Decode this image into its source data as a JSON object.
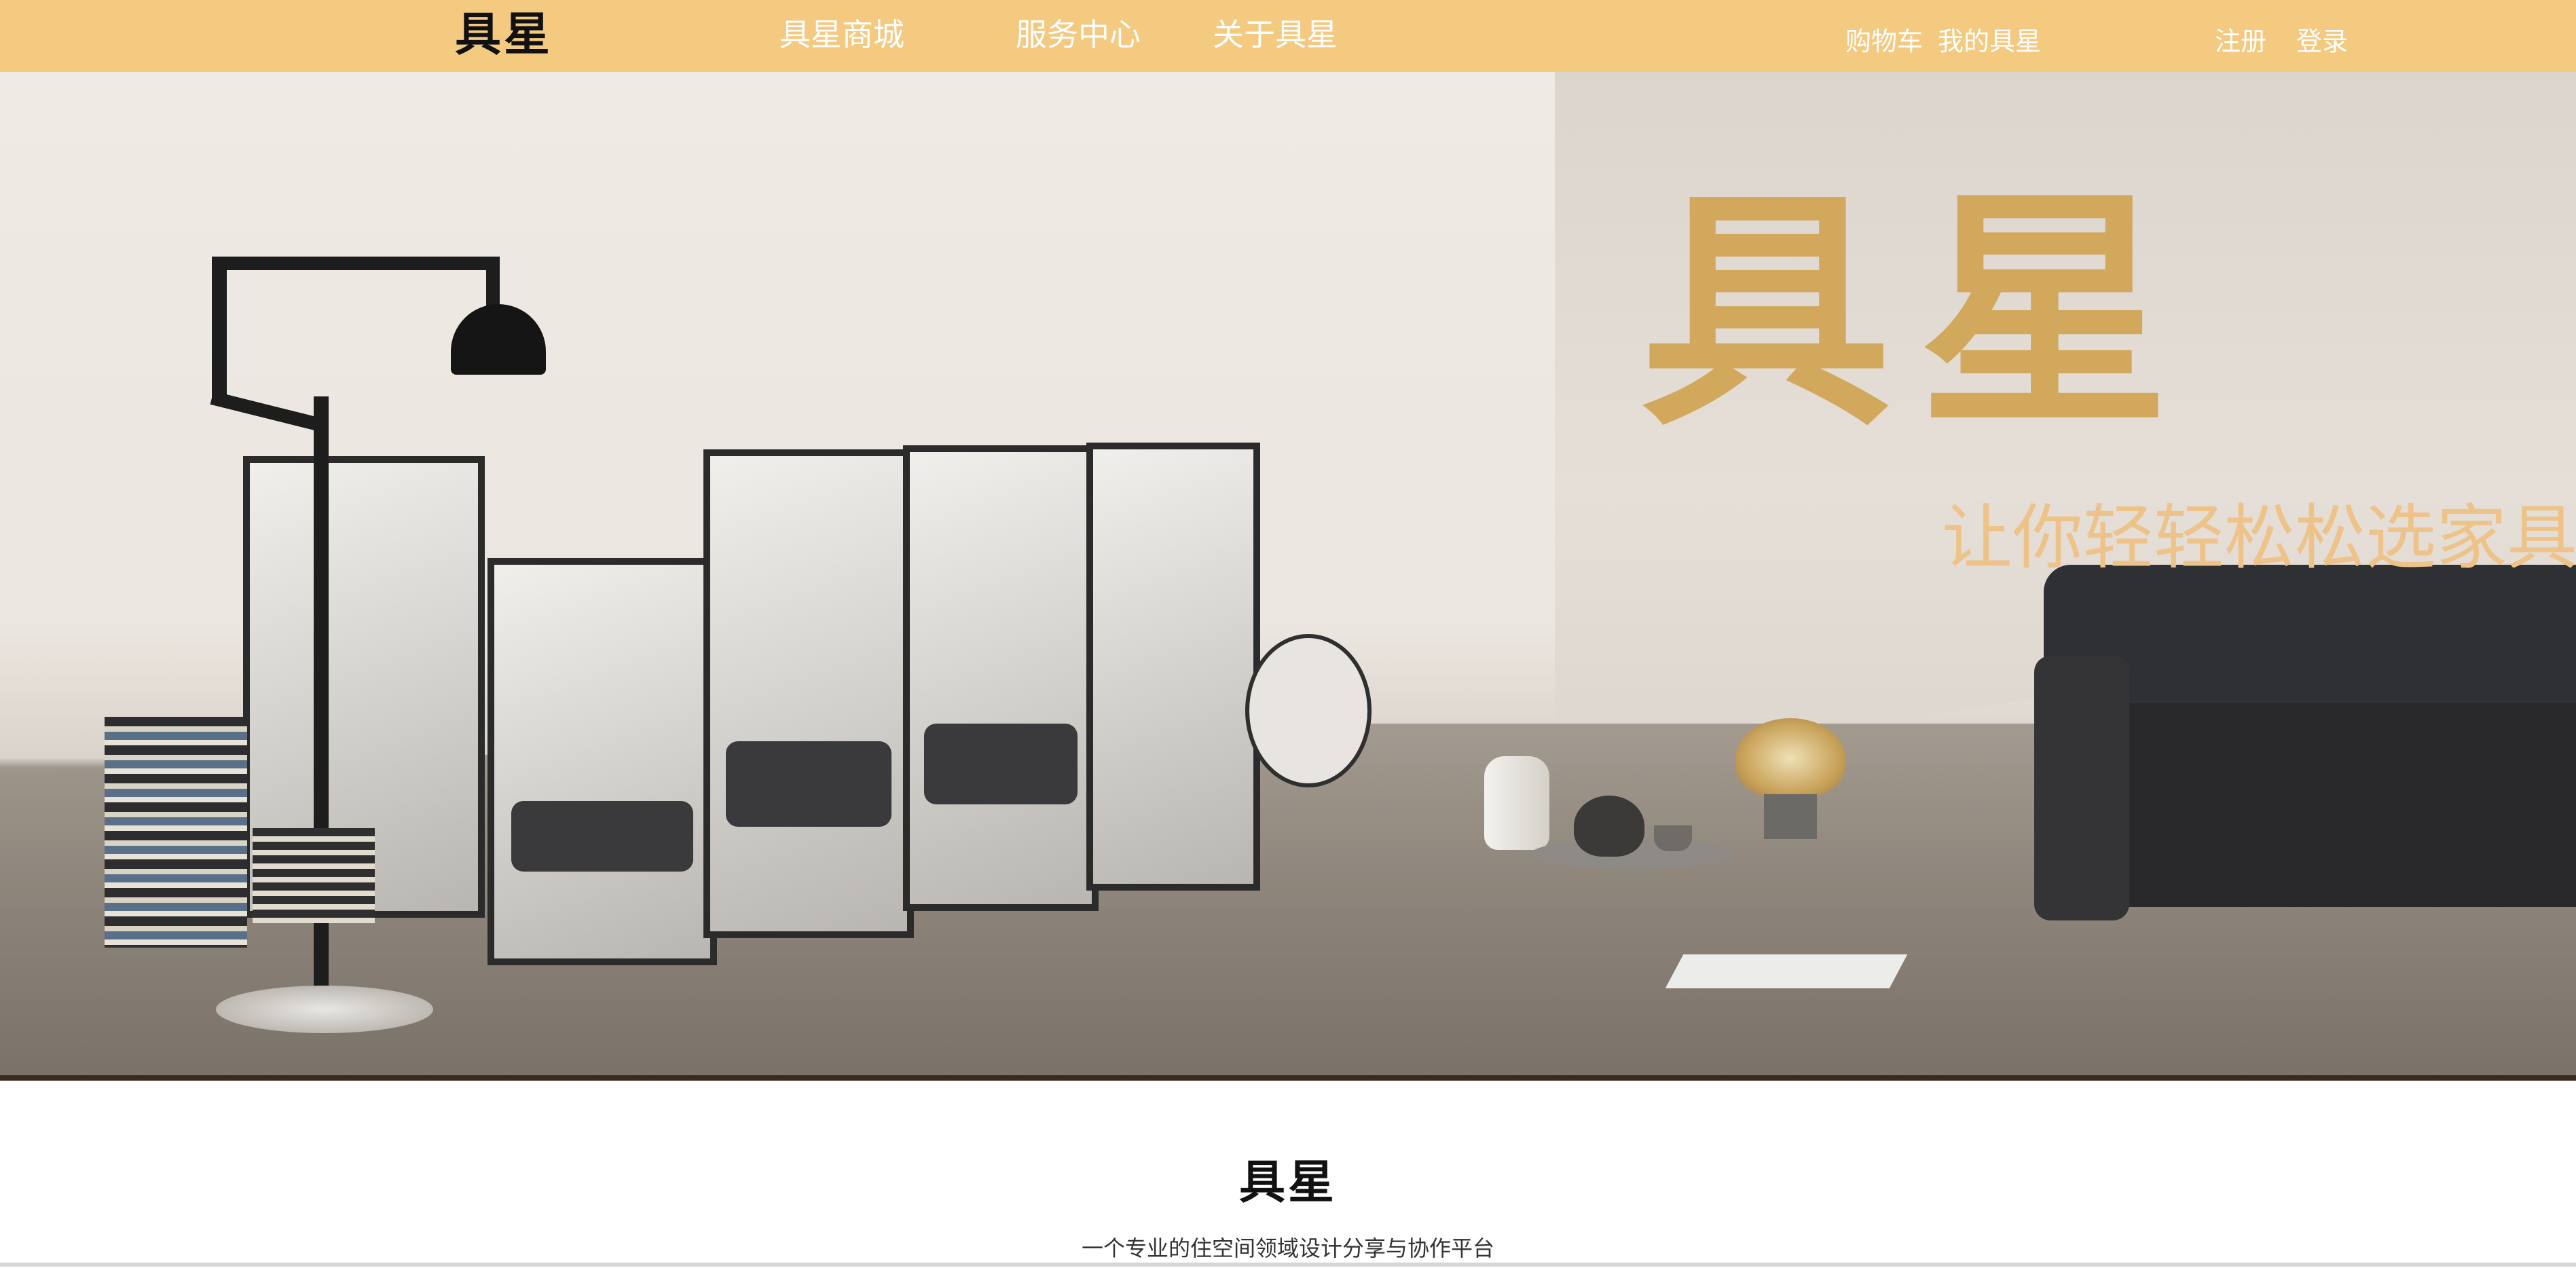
{
  "navbar": {
    "logo": "具星",
    "links": {
      "mall": "具星商城",
      "service": "服务中心",
      "about": "关于具星"
    },
    "cart": "购物车",
    "my": "我的具星",
    "register": "注册",
    "login": "登录"
  },
  "hero": {
    "title": "具星",
    "slogan": "让你轻轻松松选家具",
    "title_color": "#d1a85c",
    "slogan_color": "#eec38a"
  },
  "intro": {
    "logo": "具星",
    "tagline": "一个专业的住空间领域设计分享与协作平台"
  },
  "colors": {
    "navbar_bg": "#f4c980",
    "nav_text": "#ffffff"
  }
}
